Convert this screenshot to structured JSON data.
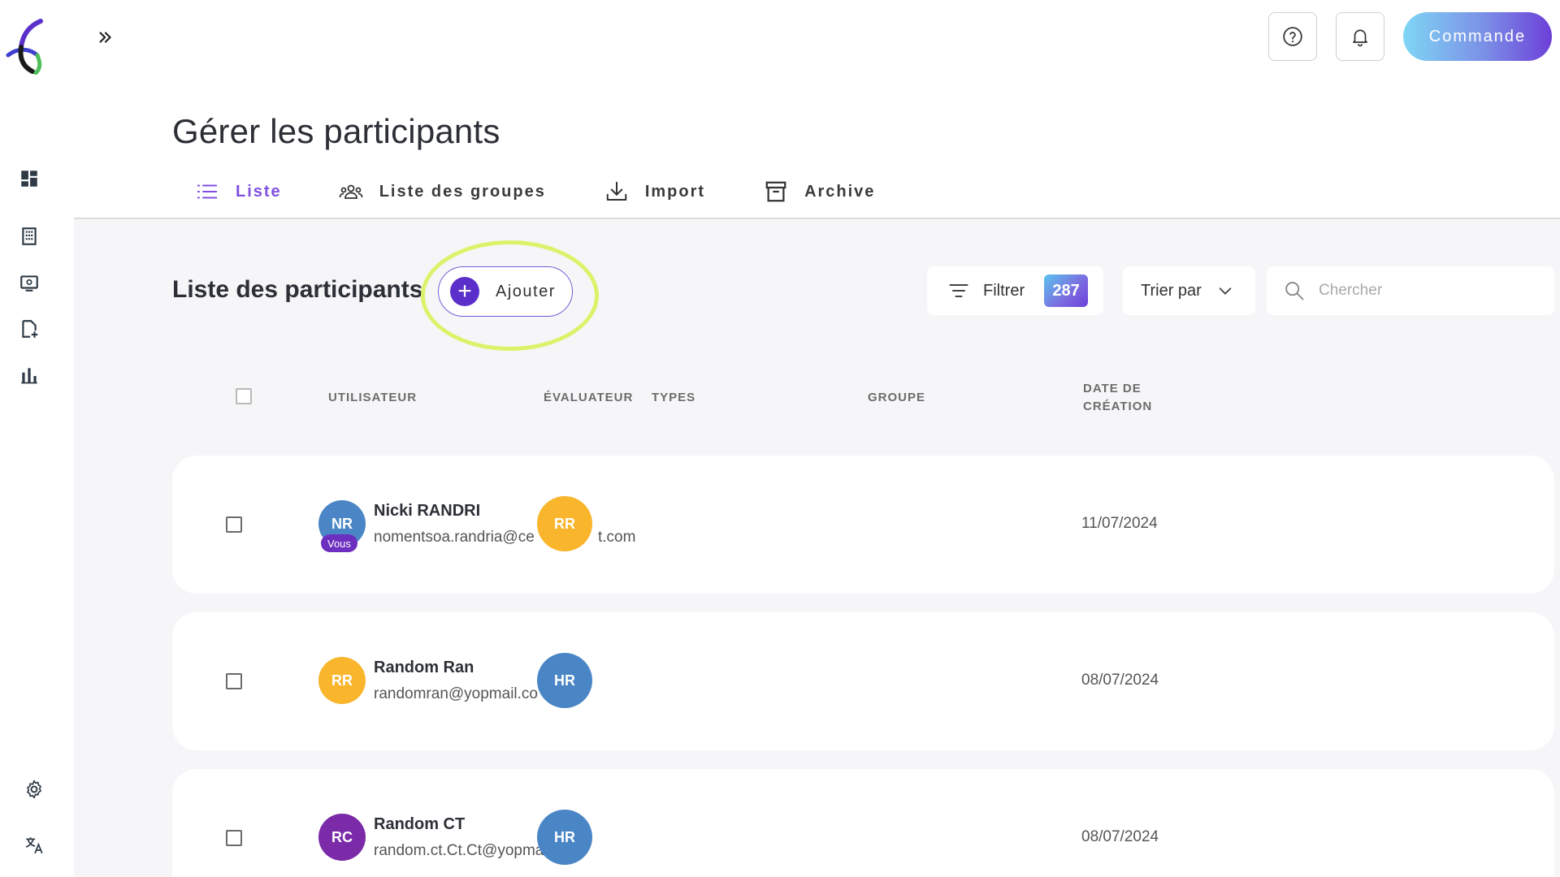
{
  "app": {
    "command_label": "Commande"
  },
  "header": {
    "title": "Gérer les participants",
    "tabs": [
      {
        "label": "Liste",
        "icon": "list-icon",
        "active": true
      },
      {
        "label": "Liste des groupes",
        "icon": "group-icon",
        "active": false
      },
      {
        "label": "Import",
        "icon": "download-icon",
        "active": false
      },
      {
        "label": "Archive",
        "icon": "archive-icon",
        "active": false
      }
    ]
  },
  "sidebar": {
    "items": [
      {
        "icon": "dashboard-icon"
      },
      {
        "icon": "building-icon"
      },
      {
        "icon": "screen-icon"
      },
      {
        "icon": "document-add-icon"
      },
      {
        "icon": "bar-chart-icon"
      }
    ],
    "bottom_items": [
      {
        "icon": "gear-icon"
      },
      {
        "icon": "translate-icon"
      }
    ]
  },
  "toolbar": {
    "list_title": "Liste des participants",
    "add_label": "Ajouter",
    "filter_label": "Filtrer",
    "filter_count": "287",
    "sort_label": "Trier par",
    "search_placeholder": "Chercher"
  },
  "table": {
    "columns": {
      "user": "UTILISATEUR",
      "evaluator": "ÉVALUATEUR",
      "types": "TYPES",
      "group": "GROUPE",
      "date_line1": "DATE DE",
      "date_line2": "CRÉATION"
    },
    "rows": [
      {
        "initials": "NR",
        "avatar_color": "#4a86c6",
        "badge": "Vous",
        "name": "Nicki RANDRI",
        "email": "nomentsoa.randria@ce",
        "email_tail": "t.com",
        "evaluator_initials": "RR",
        "evaluator_color": "#f9b52c",
        "date": "11/07/2024"
      },
      {
        "initials": "RR",
        "avatar_color": "#f9b52c",
        "name": "Random Ran",
        "email": "randomran@yopmail.co",
        "evaluator_initials": "HR",
        "evaluator_color": "#4a86c6",
        "date": "08/07/2024"
      },
      {
        "initials": "RC",
        "avatar_color": "#7b2aa8",
        "name": "Random CT",
        "email": "random.ct.Ct.Ct@yopma",
        "evaluator_initials": "HR",
        "evaluator_color": "#4a86c6",
        "date": "08/07/2024"
      }
    ]
  },
  "colors": {
    "accent": "#7f4fe0",
    "highlight": "#dcf26a",
    "add_plus": "#5b2fc9"
  }
}
